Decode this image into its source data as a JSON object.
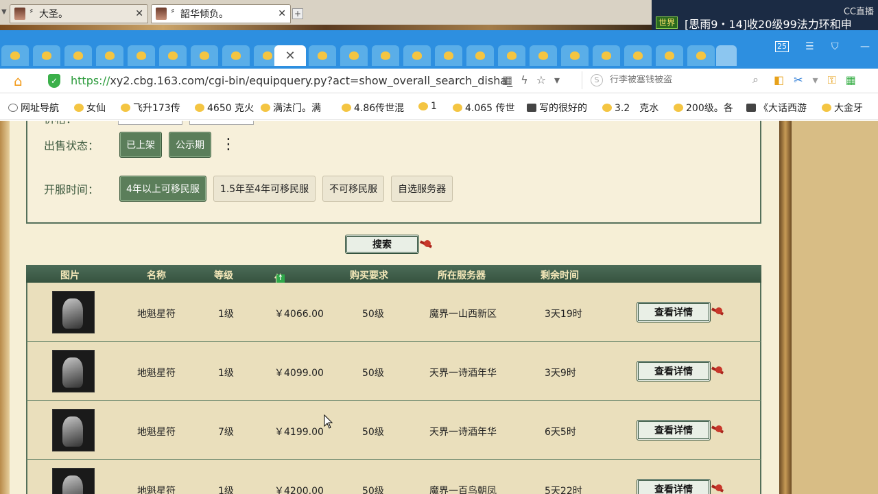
{
  "os_tabs": [
    {
      "title": "〞大圣。"
    },
    {
      "title": "〞韶华倾负。"
    }
  ],
  "world_chat": {
    "badge": "世界",
    "text": "[思雨9・14]收20级99法力环和申",
    "cc": "CC直播"
  },
  "browser": {
    "tab_count_badge": "25",
    "url_scheme": "https://",
    "url_rest": "xy2.cbg.163.com/cgi-bin/equipquery.py?act=show_overall_search_disha_",
    "search_placeholder": "行李被塞钱被盗",
    "bookmarks": [
      {
        "label": "网址导航",
        "icon": "globe-icon"
      },
      {
        "label": "女仙",
        "icon": "chick-icon"
      },
      {
        "label": "飞升173传",
        "icon": "chick-icon"
      },
      {
        "label": "4650 克火",
        "icon": "chick-icon"
      },
      {
        "label": "满法门。满",
        "icon": "chick-icon"
      },
      {
        "label": "4.86传世混",
        "icon": "chick-icon"
      },
      {
        "label": "1",
        "icon": "chick-icon"
      },
      {
        "label": "4.065 传世",
        "icon": "chick-icon"
      },
      {
        "label": "写的很好的",
        "icon": "dark-icon"
      },
      {
        "label": "3.2　克水",
        "icon": "chick-icon"
      },
      {
        "label": "200级。各",
        "icon": "chick-icon"
      },
      {
        "label": "《大话西游",
        "icon": "dark-icon"
      },
      {
        "label": "大金牙",
        "icon": "chick-icon"
      }
    ]
  },
  "filters": {
    "price_label": "价格：",
    "sale_status": {
      "label": "出售状态：",
      "options": [
        {
          "label": "已上架",
          "selected": true
        },
        {
          "label": "公示期",
          "selected": true
        }
      ]
    },
    "server_time": {
      "label": "开服时间：",
      "options": [
        {
          "label": "4年以上可移民服",
          "selected": true
        },
        {
          "label": "1.5年至4年可移民服",
          "selected": false
        },
        {
          "label": "不可移民服",
          "selected": false
        },
        {
          "label": "自选服务器",
          "selected": false
        }
      ]
    },
    "search_button": "搜索"
  },
  "table": {
    "headers": {
      "image": "图片",
      "name": "名称",
      "level": "等级",
      "price": "价格",
      "requirement": "购买要求",
      "server": "所在服务器",
      "time_left": "剩余时间"
    },
    "rows": [
      {
        "name": "地魁星符",
        "level": "1级",
        "price": "￥4066.00",
        "requirement": "50级",
        "server": "魔界一山西新区",
        "time_left": "3天19时",
        "action": "查看详情"
      },
      {
        "name": "地魁星符",
        "level": "1级",
        "price": "￥4099.00",
        "requirement": "50级",
        "server": "天界一诗酒年华",
        "time_left": "3天9时",
        "action": "查看详情"
      },
      {
        "name": "地魁星符",
        "level": "7级",
        "price": "￥4199.00",
        "requirement": "50级",
        "server": "天界一诗酒年华",
        "time_left": "6天5时",
        "action": "查看详情"
      },
      {
        "name": "地魁星符",
        "level": "1级",
        "price": "￥4200.00",
        "requirement": "50级",
        "server": "魔界一百鸟朝凤",
        "time_left": "5天22时",
        "action": "查看详情"
      }
    ]
  }
}
